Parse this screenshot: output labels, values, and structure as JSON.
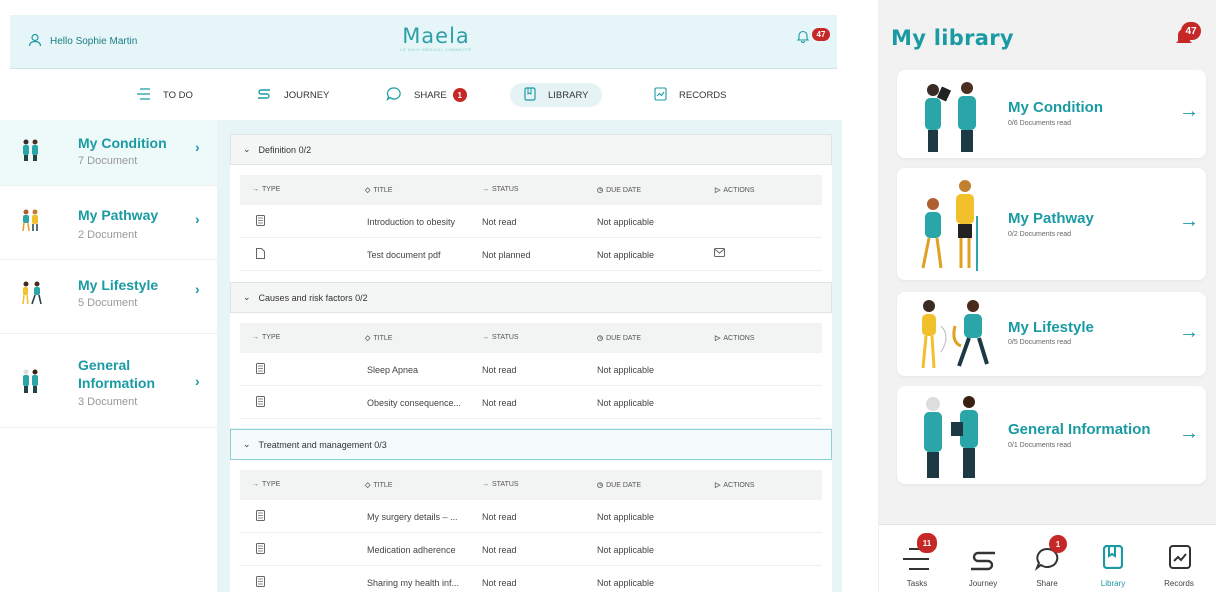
{
  "desktop": {
    "header": {
      "greeting": "Hello Sophie Martin",
      "logo": "Maela",
      "logo_subtitle": "LE SUIVI MÉDICAL CONNECTÉ",
      "notification_count": "47"
    },
    "nav": [
      {
        "label": "TO DO",
        "icon": "list-icon"
      },
      {
        "label": "JOURNEY",
        "icon": "path-icon"
      },
      {
        "label": "SHARE",
        "icon": "chat-icon",
        "badge": "1"
      },
      {
        "label": "LIBRARY",
        "icon": "book-icon",
        "active": true
      },
      {
        "label": "RECORDS",
        "icon": "chart-icon"
      }
    ],
    "sidebar": [
      {
        "title": "My Condition",
        "count": "7 Document",
        "selected": true
      },
      {
        "title": "My Pathway",
        "count": "2 Document"
      },
      {
        "title": "My Lifestyle",
        "count": "5 Document"
      },
      {
        "title": "General Information",
        "title_l1": "General",
        "title_l2": "Information",
        "count": "3 Document"
      }
    ],
    "columns": {
      "type": "TYPE",
      "title": "TITLE",
      "status": "STATUS",
      "due": "DUE DATE",
      "actions": "ACTIONS"
    },
    "sections": [
      {
        "title": "Definition 0/2",
        "rows": [
          {
            "icon": "article-icon",
            "title": "Introduction to obesity",
            "status": "Not read",
            "due": "Not applicable"
          },
          {
            "icon": "file-icon",
            "title": "Test document pdf",
            "status": "Not planned",
            "due": "Not applicable",
            "action": "mail-icon"
          }
        ]
      },
      {
        "title": "Causes and risk factors 0/2",
        "rows": [
          {
            "icon": "article-icon",
            "title": "Sleep Apnea",
            "status": "Not read",
            "due": "Not applicable"
          },
          {
            "icon": "article-icon",
            "title": "Obesity consequence...",
            "status": "Not read",
            "due": "Not applicable"
          }
        ]
      },
      {
        "title": "Treatment and management 0/3",
        "highlighted": true,
        "rows": [
          {
            "icon": "article-icon",
            "title": "My surgery details – ...",
            "status": "Not read",
            "due": "Not applicable"
          },
          {
            "icon": "article-icon",
            "title": "Medication adherence",
            "status": "Not read",
            "due": "Not applicable"
          },
          {
            "icon": "article-icon",
            "title": "Sharing my health inf...",
            "status": "Not read",
            "due": "Not applicable"
          }
        ]
      }
    ]
  },
  "mobile": {
    "title": "My library",
    "notification_count": "47",
    "cards": [
      {
        "title": "My Condition",
        "subtitle": "0/6 Documents read"
      },
      {
        "title": "My Pathway",
        "subtitle": "0/2 Documents read"
      },
      {
        "title": "My Lifestyle",
        "subtitle": "0/5 Documents read"
      },
      {
        "title": "General Information",
        "subtitle": "0/1 Documents read"
      }
    ],
    "tabs": [
      {
        "label": "Tasks",
        "icon": "list-icon",
        "badge": "11"
      },
      {
        "label": "Journey",
        "icon": "path-icon"
      },
      {
        "label": "Share",
        "icon": "chat-icon",
        "badge": "1"
      },
      {
        "label": "Library",
        "icon": "book-icon",
        "active": true
      },
      {
        "label": "Records",
        "icon": "chart-icon"
      }
    ]
  },
  "colors": {
    "accent": "#1a9ba3",
    "badge": "#c62828",
    "header_bg": "#e6f5f7",
    "content_bg": "#e8f5f7"
  }
}
